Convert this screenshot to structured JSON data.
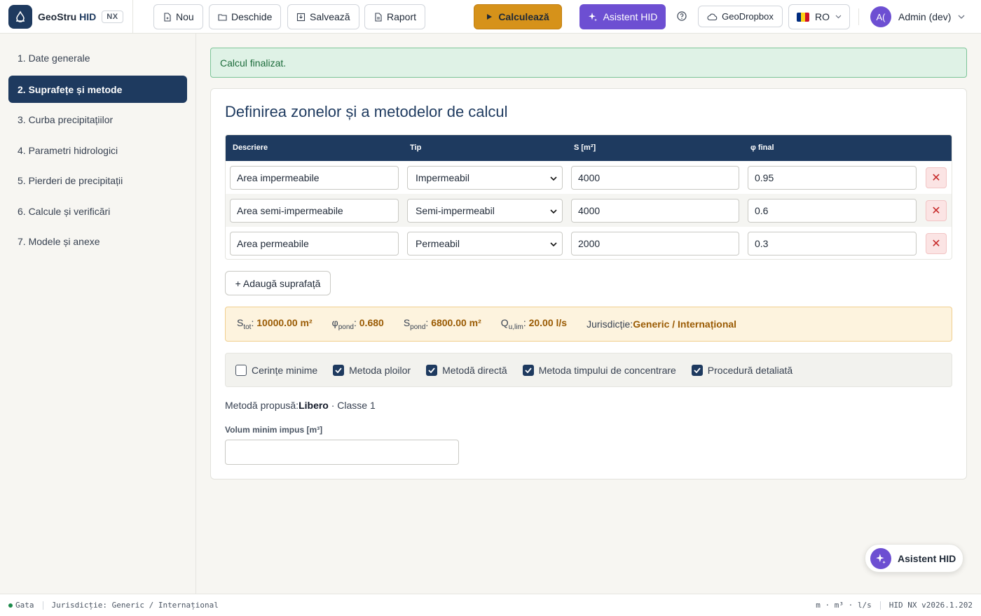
{
  "header": {
    "brand_main": "GeoStru",
    "brand_accent": "HID",
    "badge": "NX",
    "buttons": {
      "new": "Nou",
      "open": "Deschide",
      "save": "Salvează",
      "report": "Raport"
    },
    "calculate": "Calculează",
    "assistant": "Asistent HID",
    "dropbox": "GeoDropbox",
    "language": "RO",
    "avatar_initials": "A(",
    "user_name": "Admin (dev)"
  },
  "sidebar": {
    "items": [
      {
        "label": "1. Date generale"
      },
      {
        "label": "2. Suprafețe și metode",
        "active": true
      },
      {
        "label": "3. Curba precipitațiilor"
      },
      {
        "label": "4. Parametri hidrologici"
      },
      {
        "label": "5. Pierderi de precipitații"
      },
      {
        "label": "6. Calcule și verificări"
      },
      {
        "label": "7. Modele și anexe"
      }
    ]
  },
  "alert": "Calcul finalizat.",
  "card": {
    "title": "Definirea zonelor și a metodelor de calcul",
    "columns": {
      "desc": "Descriere",
      "type": "Tip",
      "area": "S [m²]",
      "phi": "φ final"
    },
    "rows": [
      {
        "desc": "Area impermeabile",
        "type": "Impermeabil",
        "area": "4000",
        "phi": "0.95"
      },
      {
        "desc": "Area semi-impermeabile",
        "type": "Semi-impermeabil",
        "area": "4000",
        "phi": "0.6"
      },
      {
        "desc": "Area permeabile",
        "type": "Permeabil",
        "area": "2000",
        "phi": "0.3"
      }
    ],
    "add_label": "+ Adaugă suprafață",
    "summary": {
      "s_tot_label": "S",
      "s_tot_sub": "tot",
      "s_tot_value": "10000.00 m²",
      "phi_label": "φ",
      "phi_sub": "pond",
      "phi_value": "0.680",
      "s_pond_label": "S",
      "s_pond_sub": "pond",
      "s_pond_value": "6800.00 m²",
      "q_label": "Q",
      "q_sub": "u,lim",
      "q_value": "20.00 l/s",
      "jur_label": "Jurisdicție:",
      "jur_value": "Generic / Internațional"
    },
    "checks": [
      {
        "label": "Cerințe minime",
        "checked": false
      },
      {
        "label": "Metoda ploilor",
        "checked": true
      },
      {
        "label": "Metodă directă",
        "checked": true
      },
      {
        "label": "Metoda timpului de concentrare",
        "checked": true
      },
      {
        "label": "Procedură detaliată",
        "checked": true
      }
    ],
    "method_label": "Metodă propusă:",
    "method_value": "Libero",
    "method_suffix": " · Classe 1",
    "volume_label": "Volum minim impus [m³]",
    "volume_value": ""
  },
  "fab_label": "Asistent HID",
  "status": {
    "state": "Gata",
    "jurisdiction": "Jurisdicție: Generic / Internațional",
    "units": "m · m³ · l/s",
    "version": "HID NX v2026.1.202"
  },
  "colors": {
    "primary": "#1e3a5f",
    "calculate": "#d6921a",
    "assistant": "#6d4fd2",
    "success": "#1b6b3a"
  }
}
